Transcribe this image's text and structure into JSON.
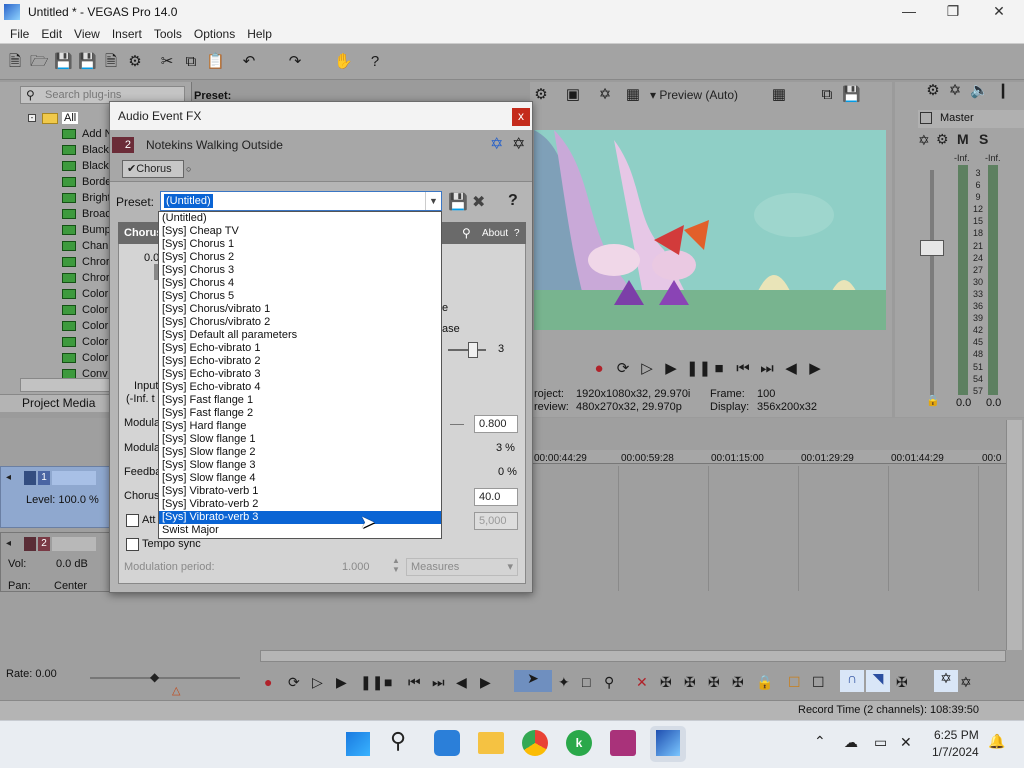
{
  "window": {
    "title": "Untitled * - VEGAS Pro 14.0"
  },
  "menu": [
    "File",
    "Edit",
    "View",
    "Insert",
    "Tools",
    "Options",
    "Help"
  ],
  "plugins": {
    "search_placeholder": "Search plug-ins",
    "preset_label": "Preset:",
    "root": "All",
    "items": [
      "Add N",
      "Black",
      "Black",
      "Borde",
      "Bright",
      "Broac",
      "Bump",
      "Chann",
      "Chror",
      "Chror",
      "Color",
      "Color",
      "Color",
      "Color",
      "Color",
      "Conv"
    ],
    "tab": "Project Media"
  },
  "preview": {
    "mode": "Preview (Auto)",
    "project_label": "roject:",
    "project_value": "1920x1080x32, 29.970i",
    "frame_label": "Frame:",
    "frame_value": "100",
    "preview_label": "review:",
    "preview_value": "480x270x32, 29.970p",
    "display_label": "Display:",
    "display_value": "356x200x32"
  },
  "master": {
    "title": "Master",
    "m": "M",
    "s": "S",
    "inf_left": "-Inf.",
    "inf_right": "-Inf.",
    "scale": [
      "3",
      "6",
      "9",
      "12",
      "15",
      "18",
      "21",
      "24",
      "27",
      "30",
      "33",
      "36",
      "39",
      "42",
      "45",
      "48",
      "51",
      "54",
      "57"
    ],
    "bottom_left": "0.0",
    "bottom_right": "0.0"
  },
  "dialog": {
    "title": "Audio Event FX",
    "close": "x",
    "track_num": "2",
    "event_name": "Notekins Walking Outside",
    "chain_item": "Chorus",
    "preset_label": "Preset:",
    "preset_value": "(Untitled)",
    "plugin_header": "Chorus",
    "about": "About",
    "about_q": "?",
    "partial_top": "0.0",
    "partial_e": "e",
    "partial_ase": "ase",
    "stages_value": "3",
    "input_label": "Input",
    "input_sub": "(-Inf. t",
    "mod1_label": "Modula",
    "mod1_value": "0.800",
    "mod2_label": "Modula",
    "mod2_value": "3 %",
    "feedback_label": "Feedba",
    "feedback_value": "0 %",
    "chorus_label": "Chorus",
    "chorus_value": "40.0",
    "att_label": "Att",
    "att_value": "5,000",
    "tempo_sync": "Tempo sync",
    "mod_period_label": "Modulation period:",
    "mod_period_value": "1.000",
    "measures": "Measures",
    "preset_list": [
      "(Untitled)",
      "[Sys] Cheap TV",
      "[Sys] Chorus 1",
      "[Sys] Chorus 2",
      "[Sys] Chorus 3",
      "[Sys] Chorus 4",
      "[Sys] Chorus 5",
      "[Sys] Chorus/vibrato 1",
      "[Sys] Chorus/vibrato 2",
      "[Sys] Default all parameters",
      "[Sys] Echo-vibrato 1",
      "[Sys] Echo-vibrato 2",
      "[Sys] Echo-vibrato 3",
      "[Sys] Echo-vibrato 4",
      "[Sys] Fast flange 1",
      "[Sys] Fast flange 2",
      "[Sys] Hard flange",
      "[Sys] Slow flange 1",
      "[Sys] Slow flange 2",
      "[Sys] Slow flange 3",
      "[Sys] Slow flange 4",
      "[Sys] Vibrato-verb 1",
      "[Sys] Vibrato-verb 2",
      "[Sys] Vibrato-verb 3",
      "Swist Major"
    ],
    "selected_index": 23
  },
  "tracks": {
    "t1_num": "1",
    "t1_level": "Level: 100.0 %",
    "t2_num": "2",
    "t2_vol_label": "Vol:",
    "t2_vol": "0.0 dB",
    "t2_pan_label": "Pan:",
    "t2_pan": "Center"
  },
  "ruler": [
    "00:00:44:29",
    "00:00:59:28",
    "00:01:15:00",
    "00:01:29:29",
    "00:01:44:29",
    "00:0"
  ],
  "rate": "Rate: 0.00",
  "record_time": "Record Time (2 channels): 108:39:50",
  "taskbar": {
    "time": "6:25 PM",
    "date": "1/7/2024"
  },
  "colors": {
    "selection": "#0a64d4",
    "track_blue": "#8fa8cf",
    "close_red": "#c42b1c"
  }
}
